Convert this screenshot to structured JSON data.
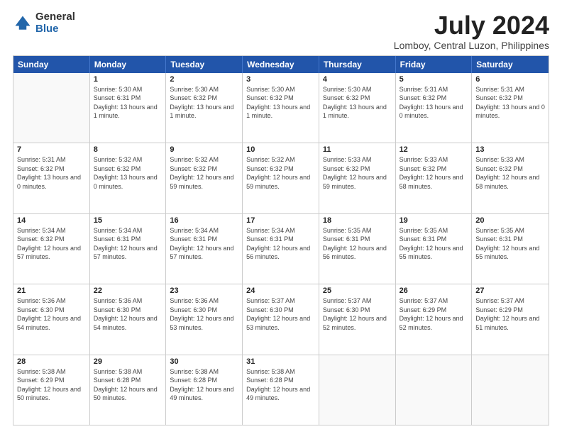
{
  "logo": {
    "general": "General",
    "blue": "Blue"
  },
  "title": "July 2024",
  "subtitle": "Lomboy, Central Luzon, Philippines",
  "header_days": [
    "Sunday",
    "Monday",
    "Tuesday",
    "Wednesday",
    "Thursday",
    "Friday",
    "Saturday"
  ],
  "weeks": [
    [
      {
        "day": "",
        "sunrise": "",
        "sunset": "",
        "daylight": ""
      },
      {
        "day": "1",
        "sunrise": "Sunrise: 5:30 AM",
        "sunset": "Sunset: 6:31 PM",
        "daylight": "Daylight: 13 hours and 1 minute."
      },
      {
        "day": "2",
        "sunrise": "Sunrise: 5:30 AM",
        "sunset": "Sunset: 6:32 PM",
        "daylight": "Daylight: 13 hours and 1 minute."
      },
      {
        "day": "3",
        "sunrise": "Sunrise: 5:30 AM",
        "sunset": "Sunset: 6:32 PM",
        "daylight": "Daylight: 13 hours and 1 minute."
      },
      {
        "day": "4",
        "sunrise": "Sunrise: 5:30 AM",
        "sunset": "Sunset: 6:32 PM",
        "daylight": "Daylight: 13 hours and 1 minute."
      },
      {
        "day": "5",
        "sunrise": "Sunrise: 5:31 AM",
        "sunset": "Sunset: 6:32 PM",
        "daylight": "Daylight: 13 hours and 0 minutes."
      },
      {
        "day": "6",
        "sunrise": "Sunrise: 5:31 AM",
        "sunset": "Sunset: 6:32 PM",
        "daylight": "Daylight: 13 hours and 0 minutes."
      }
    ],
    [
      {
        "day": "7",
        "sunrise": "Sunrise: 5:31 AM",
        "sunset": "Sunset: 6:32 PM",
        "daylight": "Daylight: 13 hours and 0 minutes."
      },
      {
        "day": "8",
        "sunrise": "Sunrise: 5:32 AM",
        "sunset": "Sunset: 6:32 PM",
        "daylight": "Daylight: 13 hours and 0 minutes."
      },
      {
        "day": "9",
        "sunrise": "Sunrise: 5:32 AM",
        "sunset": "Sunset: 6:32 PM",
        "daylight": "Daylight: 12 hours and 59 minutes."
      },
      {
        "day": "10",
        "sunrise": "Sunrise: 5:32 AM",
        "sunset": "Sunset: 6:32 PM",
        "daylight": "Daylight: 12 hours and 59 minutes."
      },
      {
        "day": "11",
        "sunrise": "Sunrise: 5:33 AM",
        "sunset": "Sunset: 6:32 PM",
        "daylight": "Daylight: 12 hours and 59 minutes."
      },
      {
        "day": "12",
        "sunrise": "Sunrise: 5:33 AM",
        "sunset": "Sunset: 6:32 PM",
        "daylight": "Daylight: 12 hours and 58 minutes."
      },
      {
        "day": "13",
        "sunrise": "Sunrise: 5:33 AM",
        "sunset": "Sunset: 6:32 PM",
        "daylight": "Daylight: 12 hours and 58 minutes."
      }
    ],
    [
      {
        "day": "14",
        "sunrise": "Sunrise: 5:34 AM",
        "sunset": "Sunset: 6:32 PM",
        "daylight": "Daylight: 12 hours and 57 minutes."
      },
      {
        "day": "15",
        "sunrise": "Sunrise: 5:34 AM",
        "sunset": "Sunset: 6:31 PM",
        "daylight": "Daylight: 12 hours and 57 minutes."
      },
      {
        "day": "16",
        "sunrise": "Sunrise: 5:34 AM",
        "sunset": "Sunset: 6:31 PM",
        "daylight": "Daylight: 12 hours and 57 minutes."
      },
      {
        "day": "17",
        "sunrise": "Sunrise: 5:34 AM",
        "sunset": "Sunset: 6:31 PM",
        "daylight": "Daylight: 12 hours and 56 minutes."
      },
      {
        "day": "18",
        "sunrise": "Sunrise: 5:35 AM",
        "sunset": "Sunset: 6:31 PM",
        "daylight": "Daylight: 12 hours and 56 minutes."
      },
      {
        "day": "19",
        "sunrise": "Sunrise: 5:35 AM",
        "sunset": "Sunset: 6:31 PM",
        "daylight": "Daylight: 12 hours and 55 minutes."
      },
      {
        "day": "20",
        "sunrise": "Sunrise: 5:35 AM",
        "sunset": "Sunset: 6:31 PM",
        "daylight": "Daylight: 12 hours and 55 minutes."
      }
    ],
    [
      {
        "day": "21",
        "sunrise": "Sunrise: 5:36 AM",
        "sunset": "Sunset: 6:30 PM",
        "daylight": "Daylight: 12 hours and 54 minutes."
      },
      {
        "day": "22",
        "sunrise": "Sunrise: 5:36 AM",
        "sunset": "Sunset: 6:30 PM",
        "daylight": "Daylight: 12 hours and 54 minutes."
      },
      {
        "day": "23",
        "sunrise": "Sunrise: 5:36 AM",
        "sunset": "Sunset: 6:30 PM",
        "daylight": "Daylight: 12 hours and 53 minutes."
      },
      {
        "day": "24",
        "sunrise": "Sunrise: 5:37 AM",
        "sunset": "Sunset: 6:30 PM",
        "daylight": "Daylight: 12 hours and 53 minutes."
      },
      {
        "day": "25",
        "sunrise": "Sunrise: 5:37 AM",
        "sunset": "Sunset: 6:30 PM",
        "daylight": "Daylight: 12 hours and 52 minutes."
      },
      {
        "day": "26",
        "sunrise": "Sunrise: 5:37 AM",
        "sunset": "Sunset: 6:29 PM",
        "daylight": "Daylight: 12 hours and 52 minutes."
      },
      {
        "day": "27",
        "sunrise": "Sunrise: 5:37 AM",
        "sunset": "Sunset: 6:29 PM",
        "daylight": "Daylight: 12 hours and 51 minutes."
      }
    ],
    [
      {
        "day": "28",
        "sunrise": "Sunrise: 5:38 AM",
        "sunset": "Sunset: 6:29 PM",
        "daylight": "Daylight: 12 hours and 50 minutes."
      },
      {
        "day": "29",
        "sunrise": "Sunrise: 5:38 AM",
        "sunset": "Sunset: 6:28 PM",
        "daylight": "Daylight: 12 hours and 50 minutes."
      },
      {
        "day": "30",
        "sunrise": "Sunrise: 5:38 AM",
        "sunset": "Sunset: 6:28 PM",
        "daylight": "Daylight: 12 hours and 49 minutes."
      },
      {
        "day": "31",
        "sunrise": "Sunrise: 5:38 AM",
        "sunset": "Sunset: 6:28 PM",
        "daylight": "Daylight: 12 hours and 49 minutes."
      },
      {
        "day": "",
        "sunrise": "",
        "sunset": "",
        "daylight": ""
      },
      {
        "day": "",
        "sunrise": "",
        "sunset": "",
        "daylight": ""
      },
      {
        "day": "",
        "sunrise": "",
        "sunset": "",
        "daylight": ""
      }
    ]
  ]
}
